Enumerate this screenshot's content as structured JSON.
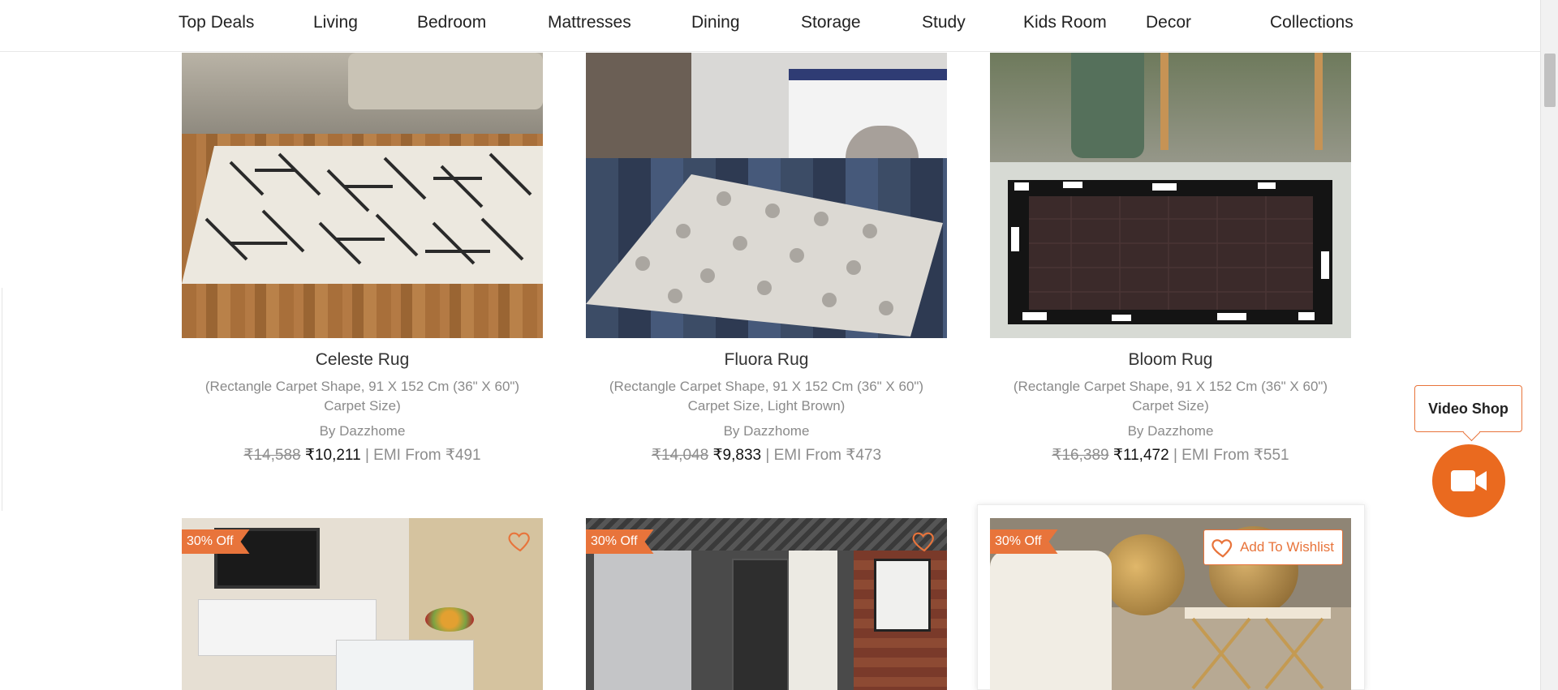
{
  "nav": {
    "items": [
      "Top Deals",
      "Living",
      "Bedroom",
      "Mattresses",
      "Dining",
      "Storage",
      "Study",
      "Kids Room",
      "Decor",
      "Collections"
    ]
  },
  "products": [
    {
      "name": "Celeste Rug",
      "desc1": "(Rectangle Carpet Shape, 91 X 152 Cm (36\" X 60\")",
      "desc2": "Carpet Size)",
      "brand": "By Dazzhome",
      "mrp": "₹14,588",
      "sale": "₹10,211",
      "emi": "| EMI From ₹491"
    },
    {
      "name": "Fluora Rug",
      "desc1": "(Rectangle Carpet Shape, 91 X 152 Cm (36\" X 60\")",
      "desc2": "Carpet Size, Light Brown)",
      "brand": "By Dazzhome",
      "mrp": "₹14,048",
      "sale": "₹9,833",
      "emi": "| EMI From ₹473"
    },
    {
      "name": "Bloom Rug",
      "desc1": "(Rectangle Carpet Shape, 91 X 152 Cm (36\" X 60\")",
      "desc2": "Carpet Size)",
      "brand": "By Dazzhome",
      "mrp": "₹16,389",
      "sale": "₹11,472",
      "emi": "| EMI From ₹551"
    }
  ],
  "row2": [
    {
      "badge": "30% Off"
    },
    {
      "badge": "30% Off"
    },
    {
      "badge": "30% Off",
      "wishlist": "Add To Wishlist"
    }
  ],
  "video_shop": {
    "label": "Video Shop",
    "icon": "video-camera-icon"
  },
  "colors": {
    "accent": "#e8743b",
    "button": "#ea6a1f"
  }
}
